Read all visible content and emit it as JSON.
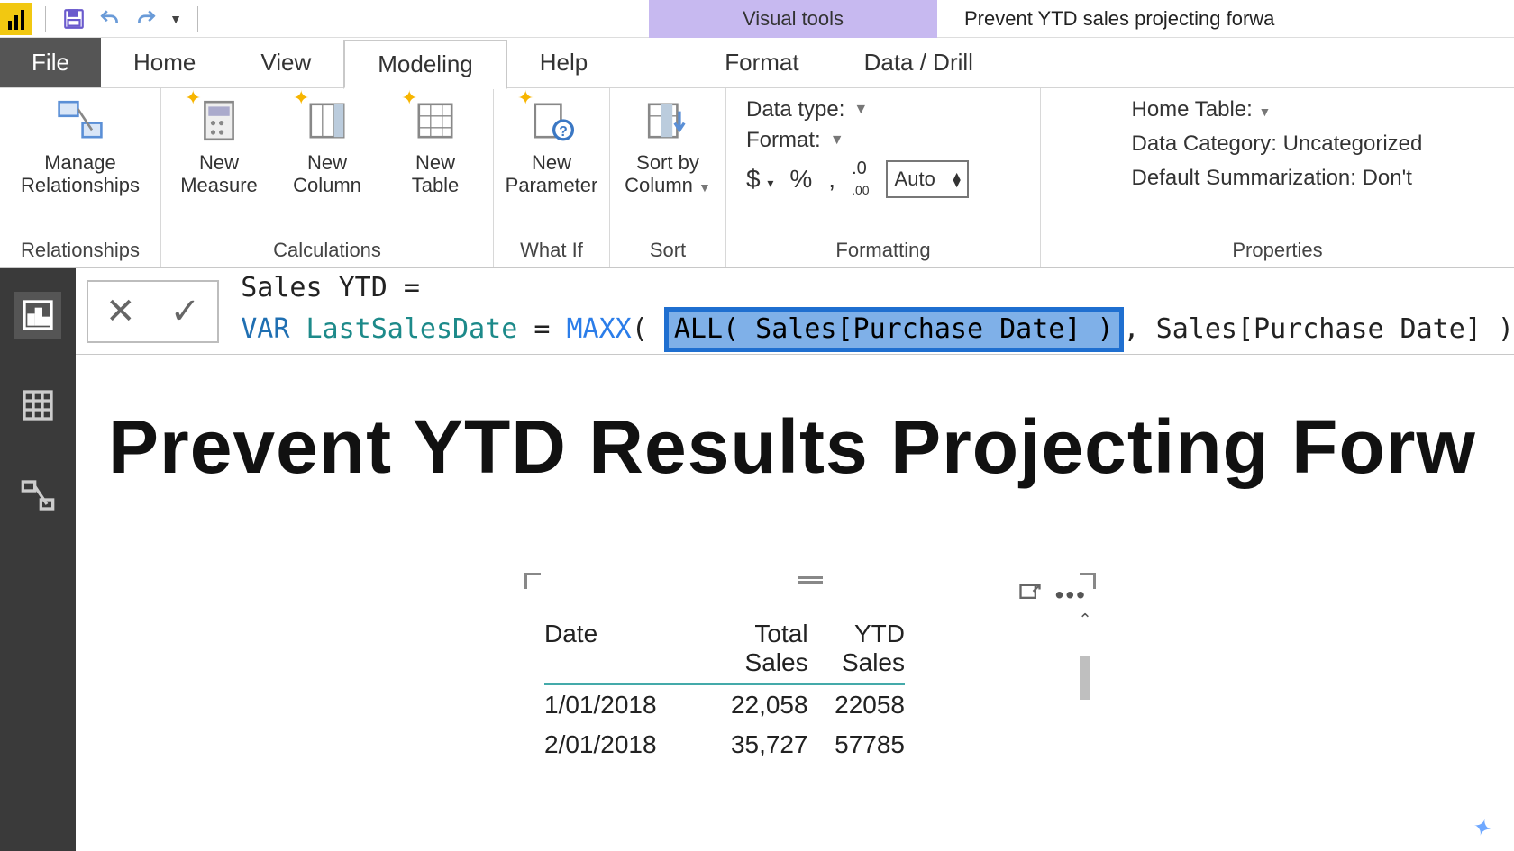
{
  "qat": {
    "visual_tools_label": "Visual tools"
  },
  "window": {
    "title": "Prevent YTD sales projecting forwa"
  },
  "tabs": {
    "file": "File",
    "home": "Home",
    "view": "View",
    "modeling": "Modeling",
    "help": "Help",
    "format": "Format",
    "data_drill": "Data / Drill"
  },
  "ribbon": {
    "relationships": {
      "manage": "Manage\nRelationships",
      "group": "Relationships"
    },
    "calculations": {
      "new_measure": "New\nMeasure",
      "new_column": "New\nColumn",
      "new_table": "New\nTable",
      "group": "Calculations"
    },
    "whatif": {
      "new_parameter": "New\nParameter",
      "group": "What If"
    },
    "sort": {
      "sort_by_column": "Sort by\nColumn",
      "group": "Sort"
    },
    "formatting": {
      "data_type": "Data type:",
      "format": "Format:",
      "auto": "Auto",
      "group": "Formatting"
    },
    "properties": {
      "home_table": "Home Table:",
      "data_category": "Data Category: Uncategorized",
      "default_summarization": "Default Summarization: Don't",
      "group": "Properties"
    }
  },
  "formula": {
    "line1_name": "Sales YTD",
    "line1_eq": " = ",
    "var": "VAR",
    "varname": "LastSalesDate",
    "eq": " = ",
    "maxx": "MAXX",
    "open": "( ",
    "all": "ALL",
    "all_args": "( Sales[Purchase Date] )",
    "after": ", Sales[Purchase Date] )"
  },
  "report": {
    "title": "Prevent YTD Results Projecting Forw"
  },
  "chart_data": {
    "type": "table",
    "columns": [
      "Date",
      "Total Sales",
      "YTD Sales"
    ],
    "rows": [
      {
        "date": "1/01/2018",
        "total_sales": "22,058",
        "ytd_sales": "22058"
      },
      {
        "date": "2/01/2018",
        "total_sales": "35,727",
        "ytd_sales": "57785"
      }
    ]
  }
}
